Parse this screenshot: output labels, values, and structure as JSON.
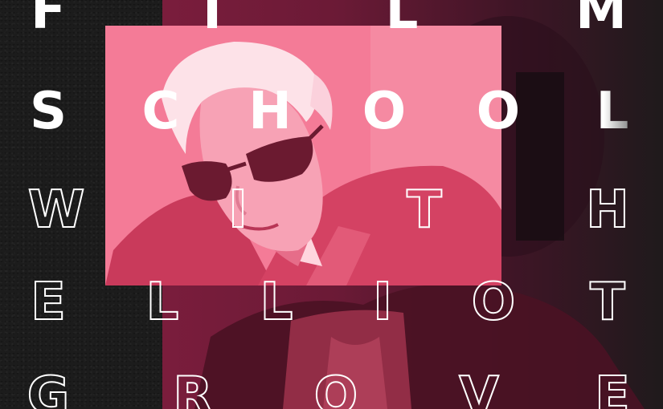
{
  "poster": {
    "rows": [
      [
        "F",
        "I",
        "L",
        "M"
      ],
      [
        "S",
        "C",
        "H",
        "O",
        "O",
        "L"
      ],
      [
        "W",
        "I",
        "T",
        "H"
      ],
      [
        "E",
        "L",
        "L",
        "I",
        "O",
        "T"
      ],
      [
        "G",
        "R",
        "O",
        "V",
        "E"
      ]
    ]
  },
  "colors": {
    "background": "#1c1c1c",
    "accent_pink": "#f26a8a",
    "dark_magenta": "#7a1d3c",
    "letter": "#ffffff"
  }
}
